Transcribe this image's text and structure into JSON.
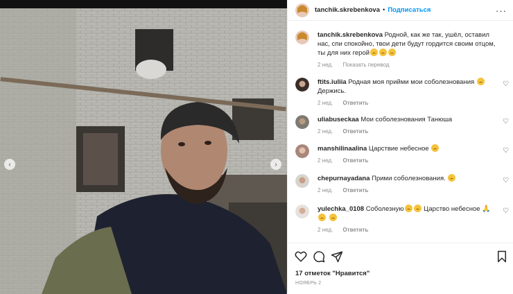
{
  "post": {
    "author": "tanchik.skrebenkova",
    "follow_label": "Подписаться",
    "caption": "Родной, как же так, ушёл, оставил нас, спи спокойно, твои дети будут гордится своим отцом, ты для них герой",
    "caption_time": "2 нед.",
    "translate_label": "Показать перевод"
  },
  "comments": [
    {
      "user": "ftits.iuliia",
      "text": "Родная моя прийми мои соболезнования",
      "text2": "Держись.",
      "time": "2 нед.",
      "reply": "Ответить"
    },
    {
      "user": "uliabuseckaa",
      "text": "Мои соболезнования Танюша",
      "time": "2 нед.",
      "reply": "Ответить"
    },
    {
      "user": "manshilinaalina",
      "text": "Царствие небесное",
      "time": "2 нед.",
      "reply": "Ответить"
    },
    {
      "user": "chepurnayadana",
      "text": "Прими соболезнования.",
      "time": "2 нед.",
      "reply": "Ответить"
    },
    {
      "user": "yulechka_0108",
      "text": "Соболезную",
      "text2": "Царство небесное",
      "time": "2 нед.",
      "reply": "Ответить"
    }
  ],
  "footer": {
    "likes": "17 отметок \"Нравится\"",
    "date": "НОЯБРЬ 2"
  },
  "colors": {
    "accent": "#0095f6",
    "muted": "#8e8e8e"
  },
  "icons": [
    "more-icon",
    "heart-icon",
    "comment-icon",
    "share-icon",
    "bookmark-icon",
    "chevron-left-icon",
    "chevron-right-icon"
  ]
}
